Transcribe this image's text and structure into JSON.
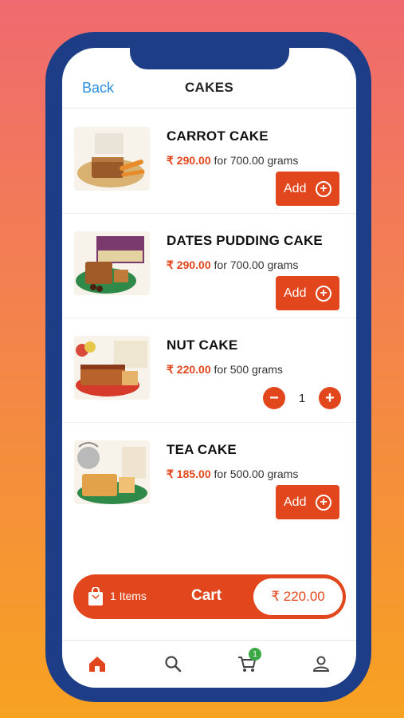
{
  "header": {
    "back_label": "Back",
    "title": "CAKES"
  },
  "products": [
    {
      "name": "CARROT CAKE",
      "price": "₹ 290.00",
      "unit": " for 700.00 grams",
      "add_label": "Add"
    },
    {
      "name": "DATES PUDDING CAKE",
      "price": "₹ 290.00",
      "unit": " for 700.00 grams",
      "add_label": "Add"
    },
    {
      "name": "NUT CAKE",
      "price": "₹ 220.00",
      "unit": " for 500 grams",
      "quantity": "1"
    },
    {
      "name": "TEA CAKE",
      "price": "₹ 185.00",
      "unit": " for 500.00 grams",
      "add_label": "Add"
    }
  ],
  "cart": {
    "items_label": "1 Items",
    "label": "Cart",
    "total": "₹ 220.00"
  },
  "tabbar": {
    "cart_badge": "1"
  },
  "colors": {
    "accent": "#e2461c",
    "link": "#2a8ee0",
    "frame": "#1d3e87",
    "badge": "#3aa845"
  },
  "icons": {
    "back": "text-link",
    "add": "plus-circle-icon",
    "stepper": [
      "minus-icon",
      "plus-icon"
    ],
    "cart_bar": "shopping-bag-icon",
    "tabs": [
      "home-icon",
      "search-icon",
      "cart-icon",
      "user-icon"
    ]
  }
}
